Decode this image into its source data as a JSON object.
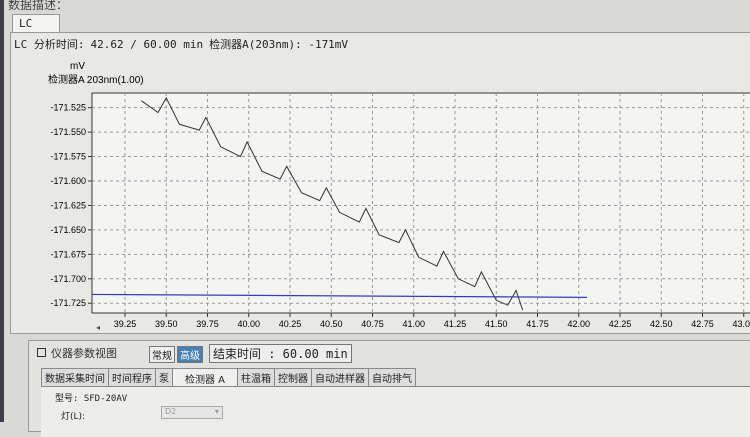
{
  "window": {
    "section_label": "数据描述："
  },
  "lc_tab": {
    "label": "LC"
  },
  "status": {
    "prefix": "LC 分析时间:",
    "time": "42.62 / 60.00 min",
    "detector": "检测器A(203nm): -171mV"
  },
  "chart_data": {
    "type": "line",
    "ylabel": "mV",
    "series_label": "检测器A 203nm(1.00)",
    "xlim": [
      39.05,
      43.05
    ],
    "ylim": [
      -171.735,
      -171.51
    ],
    "x_ticks": [
      "39.25",
      "39.50",
      "39.75",
      "40.00",
      "40.25",
      "40.50",
      "40.75",
      "41.00",
      "41.25",
      "41.50",
      "41.75",
      "42.00",
      "42.25",
      "42.50",
      "42.75",
      "43.00"
    ],
    "y_ticks": [
      "-171.525",
      "-171.550",
      "-171.575",
      "-171.600",
      "-171.625",
      "-171.650",
      "-171.675",
      "-171.700",
      "-171.725"
    ],
    "grid": true,
    "series": [
      {
        "color": "#333333",
        "x": [
          39.35,
          39.45,
          39.5,
          39.58,
          39.7,
          39.74,
          39.83,
          39.95,
          39.99,
          40.08,
          40.19,
          40.23,
          40.32,
          40.43,
          40.47,
          40.55,
          40.67,
          40.71,
          40.79,
          40.91,
          40.95,
          41.03,
          41.14,
          41.18,
          41.27,
          41.37,
          41.41,
          41.5,
          41.57,
          41.62,
          41.66
        ],
        "y": [
          -171.518,
          -171.53,
          -171.515,
          -171.542,
          -171.548,
          -171.535,
          -171.565,
          -171.575,
          -171.56,
          -171.59,
          -171.598,
          -171.585,
          -171.612,
          -171.62,
          -171.607,
          -171.632,
          -171.642,
          -171.628,
          -171.655,
          -171.663,
          -171.65,
          -171.678,
          -171.687,
          -171.672,
          -171.7,
          -171.708,
          -171.693,
          -171.722,
          -171.727,
          -171.712,
          -171.732
        ]
      },
      {
        "color": "#3a3ab8",
        "x": [
          39.05,
          42.05
        ],
        "y": [
          -171.716,
          -171.719
        ]
      }
    ]
  },
  "bottom": {
    "title": "仪器参数视图",
    "mode_normal": "常规",
    "mode_advanced": "高级",
    "end_time": "结束时间 : 60.00 min",
    "tabs": [
      "数据采集时间",
      "时间程序",
      "泵",
      "检测器 A",
      "柱温箱",
      "控制器",
      "自动进样器",
      "自动排气"
    ],
    "model": "型号: SFD-20AV",
    "lamp_label": "灯(L):",
    "lamp_value": "D2"
  }
}
